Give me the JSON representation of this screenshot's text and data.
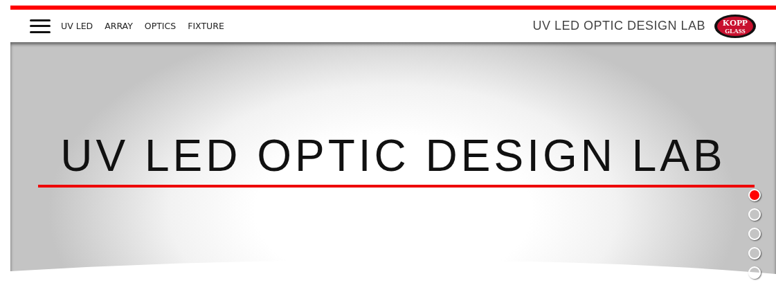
{
  "nav": {
    "links": [
      "UV LED",
      "ARRAY",
      "OPTICS",
      "FIXTURE"
    ]
  },
  "header": {
    "site_title": "UV LED OPTIC DESIGN LAB",
    "logo": {
      "main": "KOPP",
      "sub": "GLASS"
    }
  },
  "hero": {
    "title": "UV LED OPTIC DESIGN LAB"
  },
  "slides": [
    {
      "selected": true
    },
    {
      "selected": false
    },
    {
      "selected": false
    },
    {
      "selected": false
    },
    {
      "selected": false
    }
  ]
}
